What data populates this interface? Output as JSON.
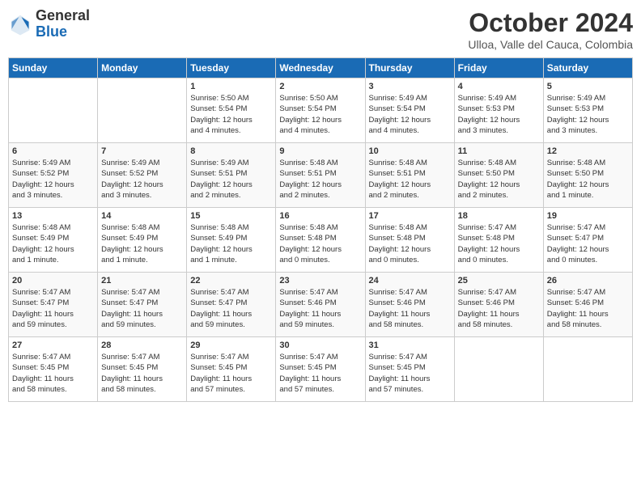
{
  "logo": {
    "general": "General",
    "blue": "Blue"
  },
  "title": "October 2024",
  "location": "Ulloa, Valle del Cauca, Colombia",
  "days_of_week": [
    "Sunday",
    "Monday",
    "Tuesday",
    "Wednesday",
    "Thursday",
    "Friday",
    "Saturday"
  ],
  "weeks": [
    [
      {
        "num": "",
        "info": ""
      },
      {
        "num": "",
        "info": ""
      },
      {
        "num": "1",
        "info": "Sunrise: 5:50 AM\nSunset: 5:54 PM\nDaylight: 12 hours\nand 4 minutes."
      },
      {
        "num": "2",
        "info": "Sunrise: 5:50 AM\nSunset: 5:54 PM\nDaylight: 12 hours\nand 4 minutes."
      },
      {
        "num": "3",
        "info": "Sunrise: 5:49 AM\nSunset: 5:54 PM\nDaylight: 12 hours\nand 4 minutes."
      },
      {
        "num": "4",
        "info": "Sunrise: 5:49 AM\nSunset: 5:53 PM\nDaylight: 12 hours\nand 3 minutes."
      },
      {
        "num": "5",
        "info": "Sunrise: 5:49 AM\nSunset: 5:53 PM\nDaylight: 12 hours\nand 3 minutes."
      }
    ],
    [
      {
        "num": "6",
        "info": "Sunrise: 5:49 AM\nSunset: 5:52 PM\nDaylight: 12 hours\nand 3 minutes."
      },
      {
        "num": "7",
        "info": "Sunrise: 5:49 AM\nSunset: 5:52 PM\nDaylight: 12 hours\nand 3 minutes."
      },
      {
        "num": "8",
        "info": "Sunrise: 5:49 AM\nSunset: 5:51 PM\nDaylight: 12 hours\nand 2 minutes."
      },
      {
        "num": "9",
        "info": "Sunrise: 5:48 AM\nSunset: 5:51 PM\nDaylight: 12 hours\nand 2 minutes."
      },
      {
        "num": "10",
        "info": "Sunrise: 5:48 AM\nSunset: 5:51 PM\nDaylight: 12 hours\nand 2 minutes."
      },
      {
        "num": "11",
        "info": "Sunrise: 5:48 AM\nSunset: 5:50 PM\nDaylight: 12 hours\nand 2 minutes."
      },
      {
        "num": "12",
        "info": "Sunrise: 5:48 AM\nSunset: 5:50 PM\nDaylight: 12 hours\nand 1 minute."
      }
    ],
    [
      {
        "num": "13",
        "info": "Sunrise: 5:48 AM\nSunset: 5:49 PM\nDaylight: 12 hours\nand 1 minute."
      },
      {
        "num": "14",
        "info": "Sunrise: 5:48 AM\nSunset: 5:49 PM\nDaylight: 12 hours\nand 1 minute."
      },
      {
        "num": "15",
        "info": "Sunrise: 5:48 AM\nSunset: 5:49 PM\nDaylight: 12 hours\nand 1 minute."
      },
      {
        "num": "16",
        "info": "Sunrise: 5:48 AM\nSunset: 5:48 PM\nDaylight: 12 hours\nand 0 minutes."
      },
      {
        "num": "17",
        "info": "Sunrise: 5:48 AM\nSunset: 5:48 PM\nDaylight: 12 hours\nand 0 minutes."
      },
      {
        "num": "18",
        "info": "Sunrise: 5:47 AM\nSunset: 5:48 PM\nDaylight: 12 hours\nand 0 minutes."
      },
      {
        "num": "19",
        "info": "Sunrise: 5:47 AM\nSunset: 5:47 PM\nDaylight: 12 hours\nand 0 minutes."
      }
    ],
    [
      {
        "num": "20",
        "info": "Sunrise: 5:47 AM\nSunset: 5:47 PM\nDaylight: 11 hours\nand 59 minutes."
      },
      {
        "num": "21",
        "info": "Sunrise: 5:47 AM\nSunset: 5:47 PM\nDaylight: 11 hours\nand 59 minutes."
      },
      {
        "num": "22",
        "info": "Sunrise: 5:47 AM\nSunset: 5:47 PM\nDaylight: 11 hours\nand 59 minutes."
      },
      {
        "num": "23",
        "info": "Sunrise: 5:47 AM\nSunset: 5:46 PM\nDaylight: 11 hours\nand 59 minutes."
      },
      {
        "num": "24",
        "info": "Sunrise: 5:47 AM\nSunset: 5:46 PM\nDaylight: 11 hours\nand 58 minutes."
      },
      {
        "num": "25",
        "info": "Sunrise: 5:47 AM\nSunset: 5:46 PM\nDaylight: 11 hours\nand 58 minutes."
      },
      {
        "num": "26",
        "info": "Sunrise: 5:47 AM\nSunset: 5:46 PM\nDaylight: 11 hours\nand 58 minutes."
      }
    ],
    [
      {
        "num": "27",
        "info": "Sunrise: 5:47 AM\nSunset: 5:45 PM\nDaylight: 11 hours\nand 58 minutes."
      },
      {
        "num": "28",
        "info": "Sunrise: 5:47 AM\nSunset: 5:45 PM\nDaylight: 11 hours\nand 58 minutes."
      },
      {
        "num": "29",
        "info": "Sunrise: 5:47 AM\nSunset: 5:45 PM\nDaylight: 11 hours\nand 57 minutes."
      },
      {
        "num": "30",
        "info": "Sunrise: 5:47 AM\nSunset: 5:45 PM\nDaylight: 11 hours\nand 57 minutes."
      },
      {
        "num": "31",
        "info": "Sunrise: 5:47 AM\nSunset: 5:45 PM\nDaylight: 11 hours\nand 57 minutes."
      },
      {
        "num": "",
        "info": ""
      },
      {
        "num": "",
        "info": ""
      }
    ]
  ]
}
